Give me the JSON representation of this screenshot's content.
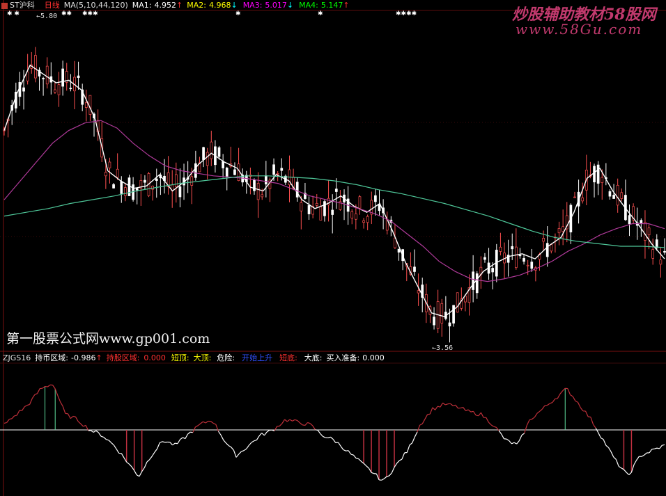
{
  "window": {
    "symbol": "ST沪科",
    "period": "日线",
    "colors": {
      "background": "#000000",
      "frame": "#7a0f0f",
      "grid": "#3a0a0a"
    }
  },
  "main_header": {
    "ma_params": "MA(5,10,44,120)",
    "ma1_label": "MA1:",
    "ma1_value": "4.952",
    "ma1_arrow": "↑",
    "ma2_label": "MA2:",
    "ma2_value": "4.968",
    "ma2_arrow": "↓",
    "ma3_label": "MA3:",
    "ma3_value": "5.017",
    "ma3_arrow": "↓",
    "ma4_label": "MA4:",
    "ma4_value": "5.147",
    "ma4_arrow": "↑",
    "colors": {
      "ma1": "#ffffff",
      "ma2": "#ffff00",
      "ma3": "#ff00ff",
      "ma4": "#00ff00"
    }
  },
  "markers": {
    "high_label": "5.80",
    "low_label": "3.56",
    "star_groups": [
      "✱ ✱",
      "✱✱",
      "✱✱✱",
      "✱",
      "✱✱✱✱"
    ]
  },
  "watermarks": {
    "top_right": "炒股辅助教材58股网",
    "top_right_url": "www.58Gu.com",
    "bottom_left": "第一股票公式网www.gp001.com"
  },
  "indicator_header": {
    "name": "ZJGS16",
    "hold_label": "持币区域:",
    "hold_value": "-0.986",
    "hold_arrow": "↑",
    "stock_label": "持股区域:",
    "stock_value": "0.000",
    "short_top_label": "短顶:",
    "big_top_label": "大顶:",
    "danger_label": "危险:",
    "blue_label": "开始上升",
    "short_bottom_label": "短底:",
    "big_bottom_label": "大底:",
    "buy_label": "买入准备:",
    "buy_value": "0.000",
    "colors": {
      "white": "#ffffff",
      "red": "#ff3030",
      "yellow": "#ffff00",
      "blue": "#3050ff",
      "green": "#80ffc0"
    }
  },
  "chart_data": {
    "type": "line",
    "series": [
      {
        "name": "MA1",
        "values": [
          5.1,
          5.4,
          5.62,
          5.55,
          5.48,
          5.5,
          5.42,
          5.2,
          4.78,
          4.7,
          4.64,
          4.66,
          4.75,
          4.62,
          4.7,
          4.83,
          4.92,
          4.85,
          4.8,
          4.65,
          4.62,
          4.75,
          4.7,
          4.55,
          4.48,
          4.52,
          4.58,
          4.5,
          4.45,
          4.52,
          4.3,
          4.05,
          3.85,
          3.65,
          3.62,
          3.7,
          3.85,
          3.98,
          4.05,
          4.1,
          4.12,
          4.08,
          4.18,
          4.25,
          4.45,
          4.72,
          4.8,
          4.62,
          4.48,
          4.35,
          4.2,
          4.08
        ]
      },
      {
        "name": "MA3",
        "values": [
          4.55,
          4.7,
          4.85,
          5.0,
          5.1,
          5.16,
          5.18,
          5.12,
          5.0,
          4.9,
          4.82,
          4.78,
          4.76,
          4.74,
          4.73,
          4.72,
          4.7,
          4.68,
          4.63,
          4.58,
          4.55,
          4.52,
          4.48,
          4.44,
          4.38,
          4.28,
          4.18,
          4.06,
          3.98,
          3.92,
          3.9,
          3.92,
          3.95,
          4.0,
          4.06,
          4.14,
          4.2,
          4.27,
          4.32,
          4.36,
          4.36,
          4.32
        ]
      },
      {
        "name": "MA4",
        "values": [
          4.42,
          4.45,
          4.48,
          4.52,
          4.55,
          4.58,
          4.62,
          4.65,
          4.68,
          4.7,
          4.72,
          4.74,
          4.74,
          4.73,
          4.72,
          4.7,
          4.67,
          4.63,
          4.6,
          4.56,
          4.52,
          4.47,
          4.42,
          4.36,
          4.3,
          4.25,
          4.22,
          4.2,
          4.18,
          4.18,
          4.17
        ]
      }
    ],
    "ylim": [
      3.4,
      6.0
    ],
    "indicator_values": [
      0.1,
      0.3,
      0.5,
      0.8,
      0.9,
      0.3,
      0.2,
      0.0,
      -0.1,
      -0.3,
      -0.6,
      -0.9,
      -0.5,
      -0.2,
      -0.3,
      -0.1,
      0.1,
      0.2,
      -0.2,
      -0.5,
      -0.3,
      -0.1,
      0.0,
      0.2,
      0.15,
      0.1,
      -0.1,
      -0.2,
      -0.4,
      -0.6,
      -0.8,
      -1.0,
      -0.7,
      -0.4,
      0.1,
      0.4,
      0.5,
      0.45,
      0.35,
      0.3,
      0.1,
      -0.2,
      -0.3,
      0.2,
      0.4,
      0.6,
      0.8,
      0.5,
      0.2,
      -0.2,
      -0.6,
      -0.9,
      -0.5,
      -0.4,
      -0.3
    ],
    "indicator_ylim": [
      -1.2,
      1.2
    ]
  }
}
